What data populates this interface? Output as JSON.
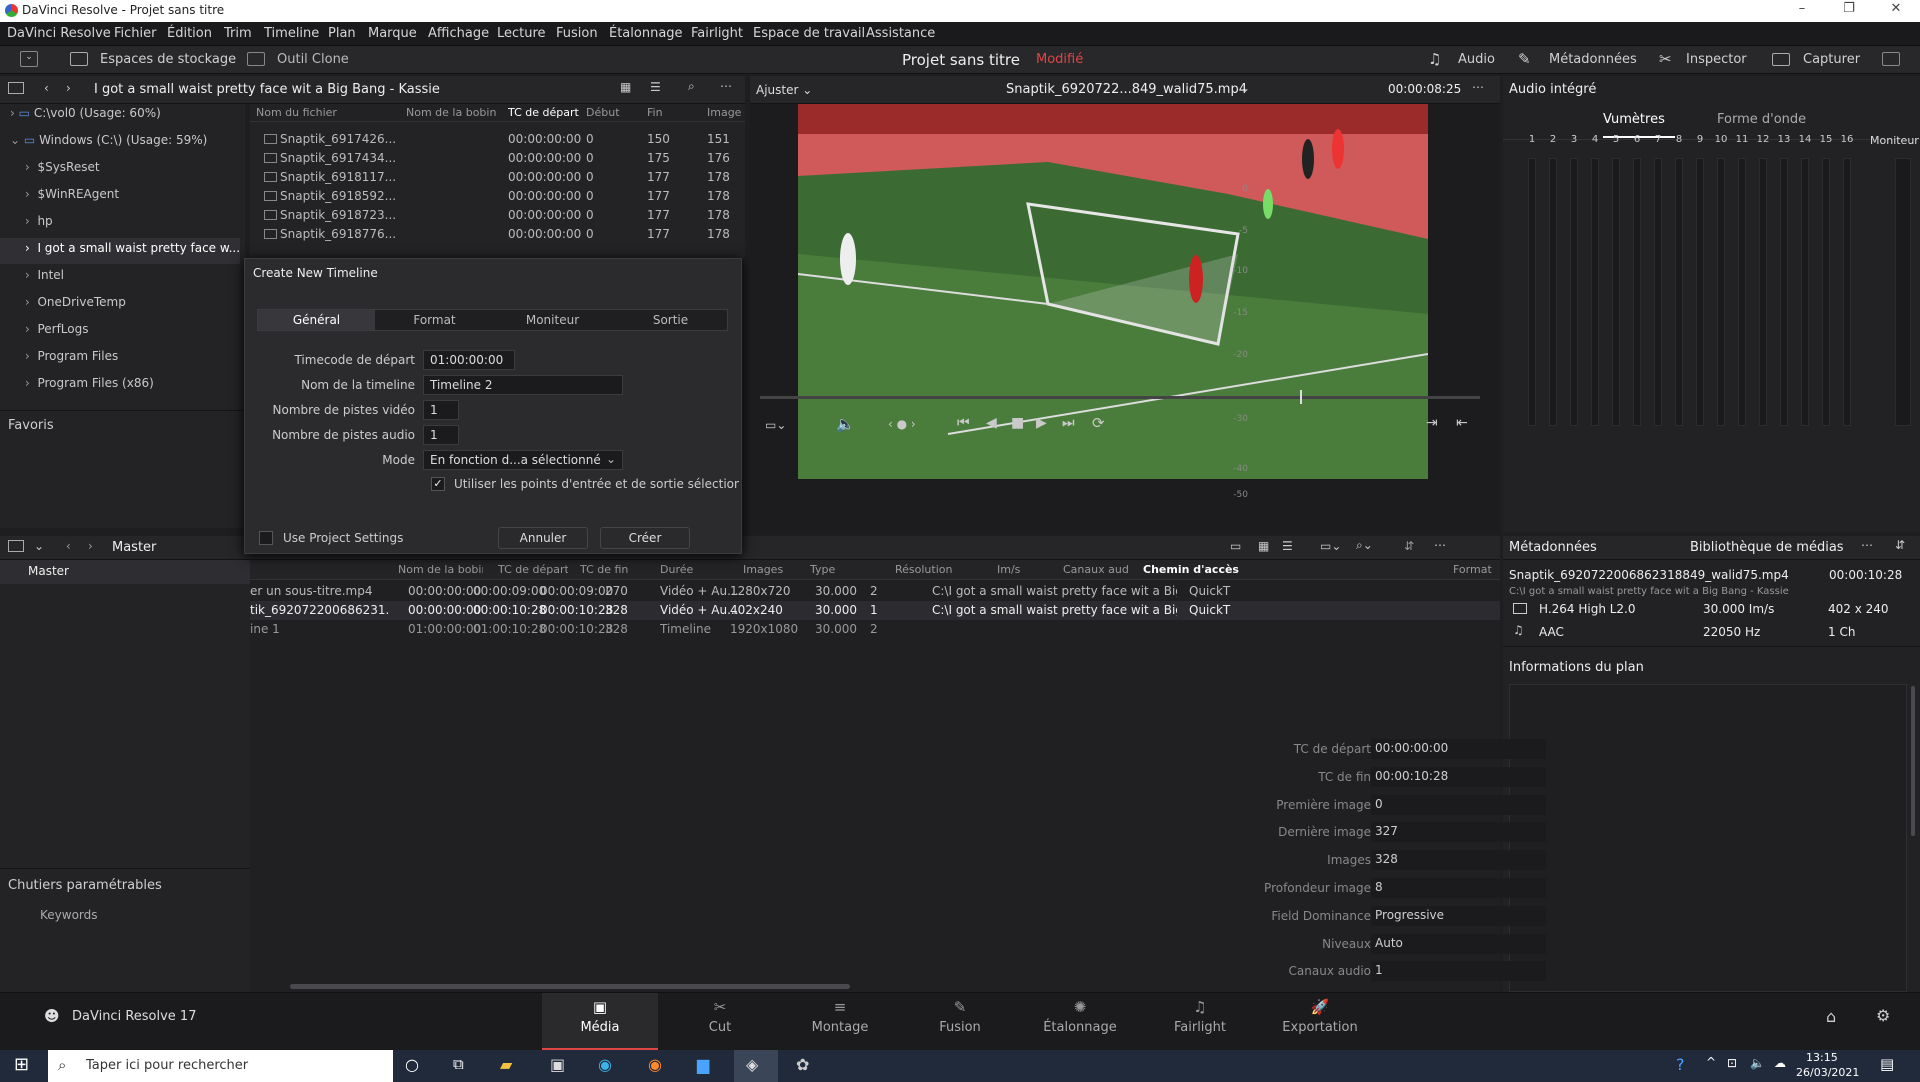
{
  "window": {
    "title": "DaVinci Resolve - Projet sans titre"
  },
  "menu": [
    "DaVinci Resolve",
    "Fichier",
    "Édition",
    "Trim",
    "Timeline",
    "Plan",
    "Marque",
    "Affichage",
    "Lecture",
    "Fusion",
    "Étalonnage",
    "Fairlight",
    "Espace de travail",
    "Assistance"
  ],
  "toolbar": {
    "storage": "Espaces de stockage",
    "clone": "Outil Clone",
    "project_title": "Projet sans titre",
    "modified": "Modifié",
    "audio": "Audio",
    "metadata": "Métadonnées",
    "inspector": "Inspector",
    "capture": "Capturer"
  },
  "storage": {
    "path": "I got a small waist pretty face wit a Big Bang - Kassie",
    "drives": [
      "C:\\vol0 (Usage: 60%)",
      "Windows (C:\\) (Usage: 59%)"
    ],
    "folders": [
      "$SysReset",
      "$WinREAgent",
      "hp",
      "I got a small waist pretty face w...",
      "Intel",
      "OneDriveTemp",
      "PerfLogs",
      "Program Files",
      "Program Files (x86)"
    ],
    "favorites": "Favoris"
  },
  "filelist": {
    "columns": [
      "Nom du fichier",
      "Nom de la bobin",
      "TC de départ",
      "Début",
      "Fin",
      "Image"
    ],
    "rows": [
      [
        "Snaptik_6917426...",
        "",
        "00:00:00:00",
        "0",
        "150",
        "151"
      ],
      [
        "Snaptik_6917434...",
        "",
        "00:00:00:00",
        "0",
        "175",
        "176"
      ],
      [
        "Snaptik_6918117...",
        "",
        "00:00:00:00",
        "0",
        "177",
        "178"
      ],
      [
        "Snaptik_6918592...",
        "",
        "00:00:00:00",
        "0",
        "177",
        "178"
      ],
      [
        "Snaptik_6918723...",
        "",
        "00:00:00:00",
        "0",
        "177",
        "178"
      ],
      [
        "Snaptik_6918776...",
        "",
        "00:00:00:00",
        "0",
        "177",
        "178"
      ]
    ]
  },
  "dialog": {
    "title": "Create New Timeline",
    "tabs": [
      "Général",
      "Format",
      "Moniteur",
      "Sortie"
    ],
    "labels": {
      "start_tc": "Timecode de départ",
      "name": "Nom de la timeline",
      "video_tracks": "Nombre de pistes vidéo",
      "audio_tracks": "Nombre de pistes audio",
      "mode": "Mode"
    },
    "values": {
      "start_tc": "01:00:00:00",
      "name": "Timeline 2",
      "video_tracks": "1",
      "audio_tracks": "1",
      "mode": "En fonction d...a sélectionné"
    },
    "use_inout": "Utiliser les points d'entrée et de sortie sélectionnés",
    "use_project": "Use Project Settings",
    "cancel": "Annuler",
    "create": "Créer"
  },
  "viewer": {
    "fit": "Ajuster",
    "clip_name": "Snaptik_6920722...849_walid75.mp4",
    "timecode": "00:00:08:25"
  },
  "audio": {
    "title": "Audio intégré",
    "tabs": [
      "Vumètres",
      "Forme d'onde"
    ],
    "channels": [
      "1",
      "2",
      "3",
      "4",
      "5",
      "6",
      "7",
      "8",
      "9",
      "10",
      "11",
      "12",
      "13",
      "14",
      "15",
      "16"
    ],
    "monitor": "Moniteur",
    "db": [
      "0",
      "-5",
      "-10",
      "-15",
      "-20",
      "-30",
      "-40",
      "-50"
    ]
  },
  "bins": {
    "header": "Master",
    "master": "Master",
    "smart": "Chutiers paramétrables",
    "keywords": "Keywords"
  },
  "mediapool": {
    "columns": [
      "Nom du fichier",
      "Nom de la bobin",
      "TC de départ",
      "TC de fin",
      "Durée",
      "Images",
      "Type",
      "Résolution",
      "Im/s",
      "Canaux aud",
      "Chemin d'accès",
      "Format"
    ],
    "rows": [
      [
        "er un sous-titre.mp4",
        "",
        "00:00:00:00",
        "00:00:09:00",
        "00:00:09:00",
        "270",
        "Vidéo + Au...",
        "1280x720",
        "30.000",
        "2",
        "C:\\I got a small waist pretty face wit a Big Bang - K...",
        "QuickT"
      ],
      [
        "tik_692072200686231...",
        "",
        "00:00:00:00",
        "00:00:10:28",
        "00:00:10:28",
        "328",
        "Vidéo + Au...",
        "402x240",
        "30.000",
        "1",
        "C:\\I got a small waist pretty face wit a Big Bang - K...",
        "QuickT"
      ],
      [
        "ine 1",
        "",
        "01:00:00:00",
        "01:00:10:28",
        "00:00:10:28",
        "328",
        "Timeline",
        "1920x1080",
        "30.000",
        "2",
        "",
        ""
      ]
    ]
  },
  "metadata": {
    "title": "Métadonnées",
    "library": "Bibliothèque de médias",
    "clip": "Snaptik_6920722006862318849_walid75.mp4",
    "duration": "00:00:10:28",
    "path": "C:\\I got a small waist pretty face wit a Big Bang - Kassie",
    "video_codec": "H.264 High L2.0",
    "fps": "30.000 Im/s",
    "res": "402 x 240",
    "audio_codec": "AAC",
    "rate": "22050 Hz",
    "channels": "1 Ch",
    "section": "Informations du plan",
    "fields": [
      {
        "label": "TC de départ",
        "value": "00:00:00:00"
      },
      {
        "label": "TC de fin",
        "value": "00:00:10:28"
      },
      {
        "label": "Première image",
        "value": "0"
      },
      {
        "label": "Dernière image",
        "value": "327"
      },
      {
        "label": "Images",
        "value": "328"
      },
      {
        "label": "Profondeur image",
        "value": "8"
      },
      {
        "label": "Field Dominance",
        "value": "Progressive"
      },
      {
        "label": "Niveaux",
        "value": "Auto"
      },
      {
        "label": "Canaux audio",
        "value": "1"
      }
    ]
  },
  "pages": {
    "app": "DaVinci Resolve 17",
    "items": [
      "Média",
      "Cut",
      "Montage",
      "Fusion",
      "Étalonnage",
      "Fairlight",
      "Exportation"
    ]
  },
  "taskbar": {
    "search": "Taper ici pour rechercher",
    "time": "13:15",
    "date": "26/03/2021"
  }
}
